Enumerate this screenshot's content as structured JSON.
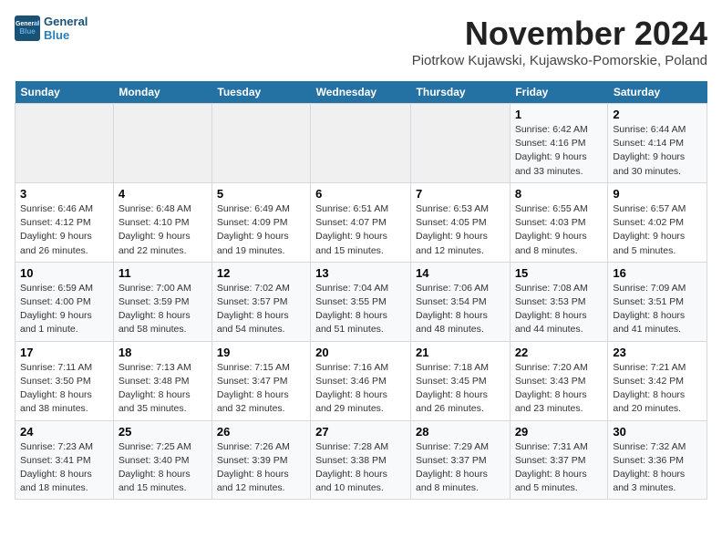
{
  "logo": {
    "line1": "General",
    "line2": "Blue"
  },
  "title": "November 2024",
  "subtitle": "Piotrkow Kujawski, Kujawsko-Pomorskie, Poland",
  "weekdays": [
    "Sunday",
    "Monday",
    "Tuesday",
    "Wednesday",
    "Thursday",
    "Friday",
    "Saturday"
  ],
  "weeks": [
    [
      {
        "day": "",
        "info": ""
      },
      {
        "day": "",
        "info": ""
      },
      {
        "day": "",
        "info": ""
      },
      {
        "day": "",
        "info": ""
      },
      {
        "day": "",
        "info": ""
      },
      {
        "day": "1",
        "info": "Sunrise: 6:42 AM\nSunset: 4:16 PM\nDaylight: 9 hours\nand 33 minutes."
      },
      {
        "day": "2",
        "info": "Sunrise: 6:44 AM\nSunset: 4:14 PM\nDaylight: 9 hours\nand 30 minutes."
      }
    ],
    [
      {
        "day": "3",
        "info": "Sunrise: 6:46 AM\nSunset: 4:12 PM\nDaylight: 9 hours\nand 26 minutes."
      },
      {
        "day": "4",
        "info": "Sunrise: 6:48 AM\nSunset: 4:10 PM\nDaylight: 9 hours\nand 22 minutes."
      },
      {
        "day": "5",
        "info": "Sunrise: 6:49 AM\nSunset: 4:09 PM\nDaylight: 9 hours\nand 19 minutes."
      },
      {
        "day": "6",
        "info": "Sunrise: 6:51 AM\nSunset: 4:07 PM\nDaylight: 9 hours\nand 15 minutes."
      },
      {
        "day": "7",
        "info": "Sunrise: 6:53 AM\nSunset: 4:05 PM\nDaylight: 9 hours\nand 12 minutes."
      },
      {
        "day": "8",
        "info": "Sunrise: 6:55 AM\nSunset: 4:03 PM\nDaylight: 9 hours\nand 8 minutes."
      },
      {
        "day": "9",
        "info": "Sunrise: 6:57 AM\nSunset: 4:02 PM\nDaylight: 9 hours\nand 5 minutes."
      }
    ],
    [
      {
        "day": "10",
        "info": "Sunrise: 6:59 AM\nSunset: 4:00 PM\nDaylight: 9 hours\nand 1 minute."
      },
      {
        "day": "11",
        "info": "Sunrise: 7:00 AM\nSunset: 3:59 PM\nDaylight: 8 hours\nand 58 minutes."
      },
      {
        "day": "12",
        "info": "Sunrise: 7:02 AM\nSunset: 3:57 PM\nDaylight: 8 hours\nand 54 minutes."
      },
      {
        "day": "13",
        "info": "Sunrise: 7:04 AM\nSunset: 3:55 PM\nDaylight: 8 hours\nand 51 minutes."
      },
      {
        "day": "14",
        "info": "Sunrise: 7:06 AM\nSunset: 3:54 PM\nDaylight: 8 hours\nand 48 minutes."
      },
      {
        "day": "15",
        "info": "Sunrise: 7:08 AM\nSunset: 3:53 PM\nDaylight: 8 hours\nand 44 minutes."
      },
      {
        "day": "16",
        "info": "Sunrise: 7:09 AM\nSunset: 3:51 PM\nDaylight: 8 hours\nand 41 minutes."
      }
    ],
    [
      {
        "day": "17",
        "info": "Sunrise: 7:11 AM\nSunset: 3:50 PM\nDaylight: 8 hours\nand 38 minutes."
      },
      {
        "day": "18",
        "info": "Sunrise: 7:13 AM\nSunset: 3:48 PM\nDaylight: 8 hours\nand 35 minutes."
      },
      {
        "day": "19",
        "info": "Sunrise: 7:15 AM\nSunset: 3:47 PM\nDaylight: 8 hours\nand 32 minutes."
      },
      {
        "day": "20",
        "info": "Sunrise: 7:16 AM\nSunset: 3:46 PM\nDaylight: 8 hours\nand 29 minutes."
      },
      {
        "day": "21",
        "info": "Sunrise: 7:18 AM\nSunset: 3:45 PM\nDaylight: 8 hours\nand 26 minutes."
      },
      {
        "day": "22",
        "info": "Sunrise: 7:20 AM\nSunset: 3:43 PM\nDaylight: 8 hours\nand 23 minutes."
      },
      {
        "day": "23",
        "info": "Sunrise: 7:21 AM\nSunset: 3:42 PM\nDaylight: 8 hours\nand 20 minutes."
      }
    ],
    [
      {
        "day": "24",
        "info": "Sunrise: 7:23 AM\nSunset: 3:41 PM\nDaylight: 8 hours\nand 18 minutes."
      },
      {
        "day": "25",
        "info": "Sunrise: 7:25 AM\nSunset: 3:40 PM\nDaylight: 8 hours\nand 15 minutes."
      },
      {
        "day": "26",
        "info": "Sunrise: 7:26 AM\nSunset: 3:39 PM\nDaylight: 8 hours\nand 12 minutes."
      },
      {
        "day": "27",
        "info": "Sunrise: 7:28 AM\nSunset: 3:38 PM\nDaylight: 8 hours\nand 10 minutes."
      },
      {
        "day": "28",
        "info": "Sunrise: 7:29 AM\nSunset: 3:37 PM\nDaylight: 8 hours\nand 8 minutes."
      },
      {
        "day": "29",
        "info": "Sunrise: 7:31 AM\nSunset: 3:37 PM\nDaylight: 8 hours\nand 5 minutes."
      },
      {
        "day": "30",
        "info": "Sunrise: 7:32 AM\nSunset: 3:36 PM\nDaylight: 8 hours\nand 3 minutes."
      }
    ]
  ]
}
